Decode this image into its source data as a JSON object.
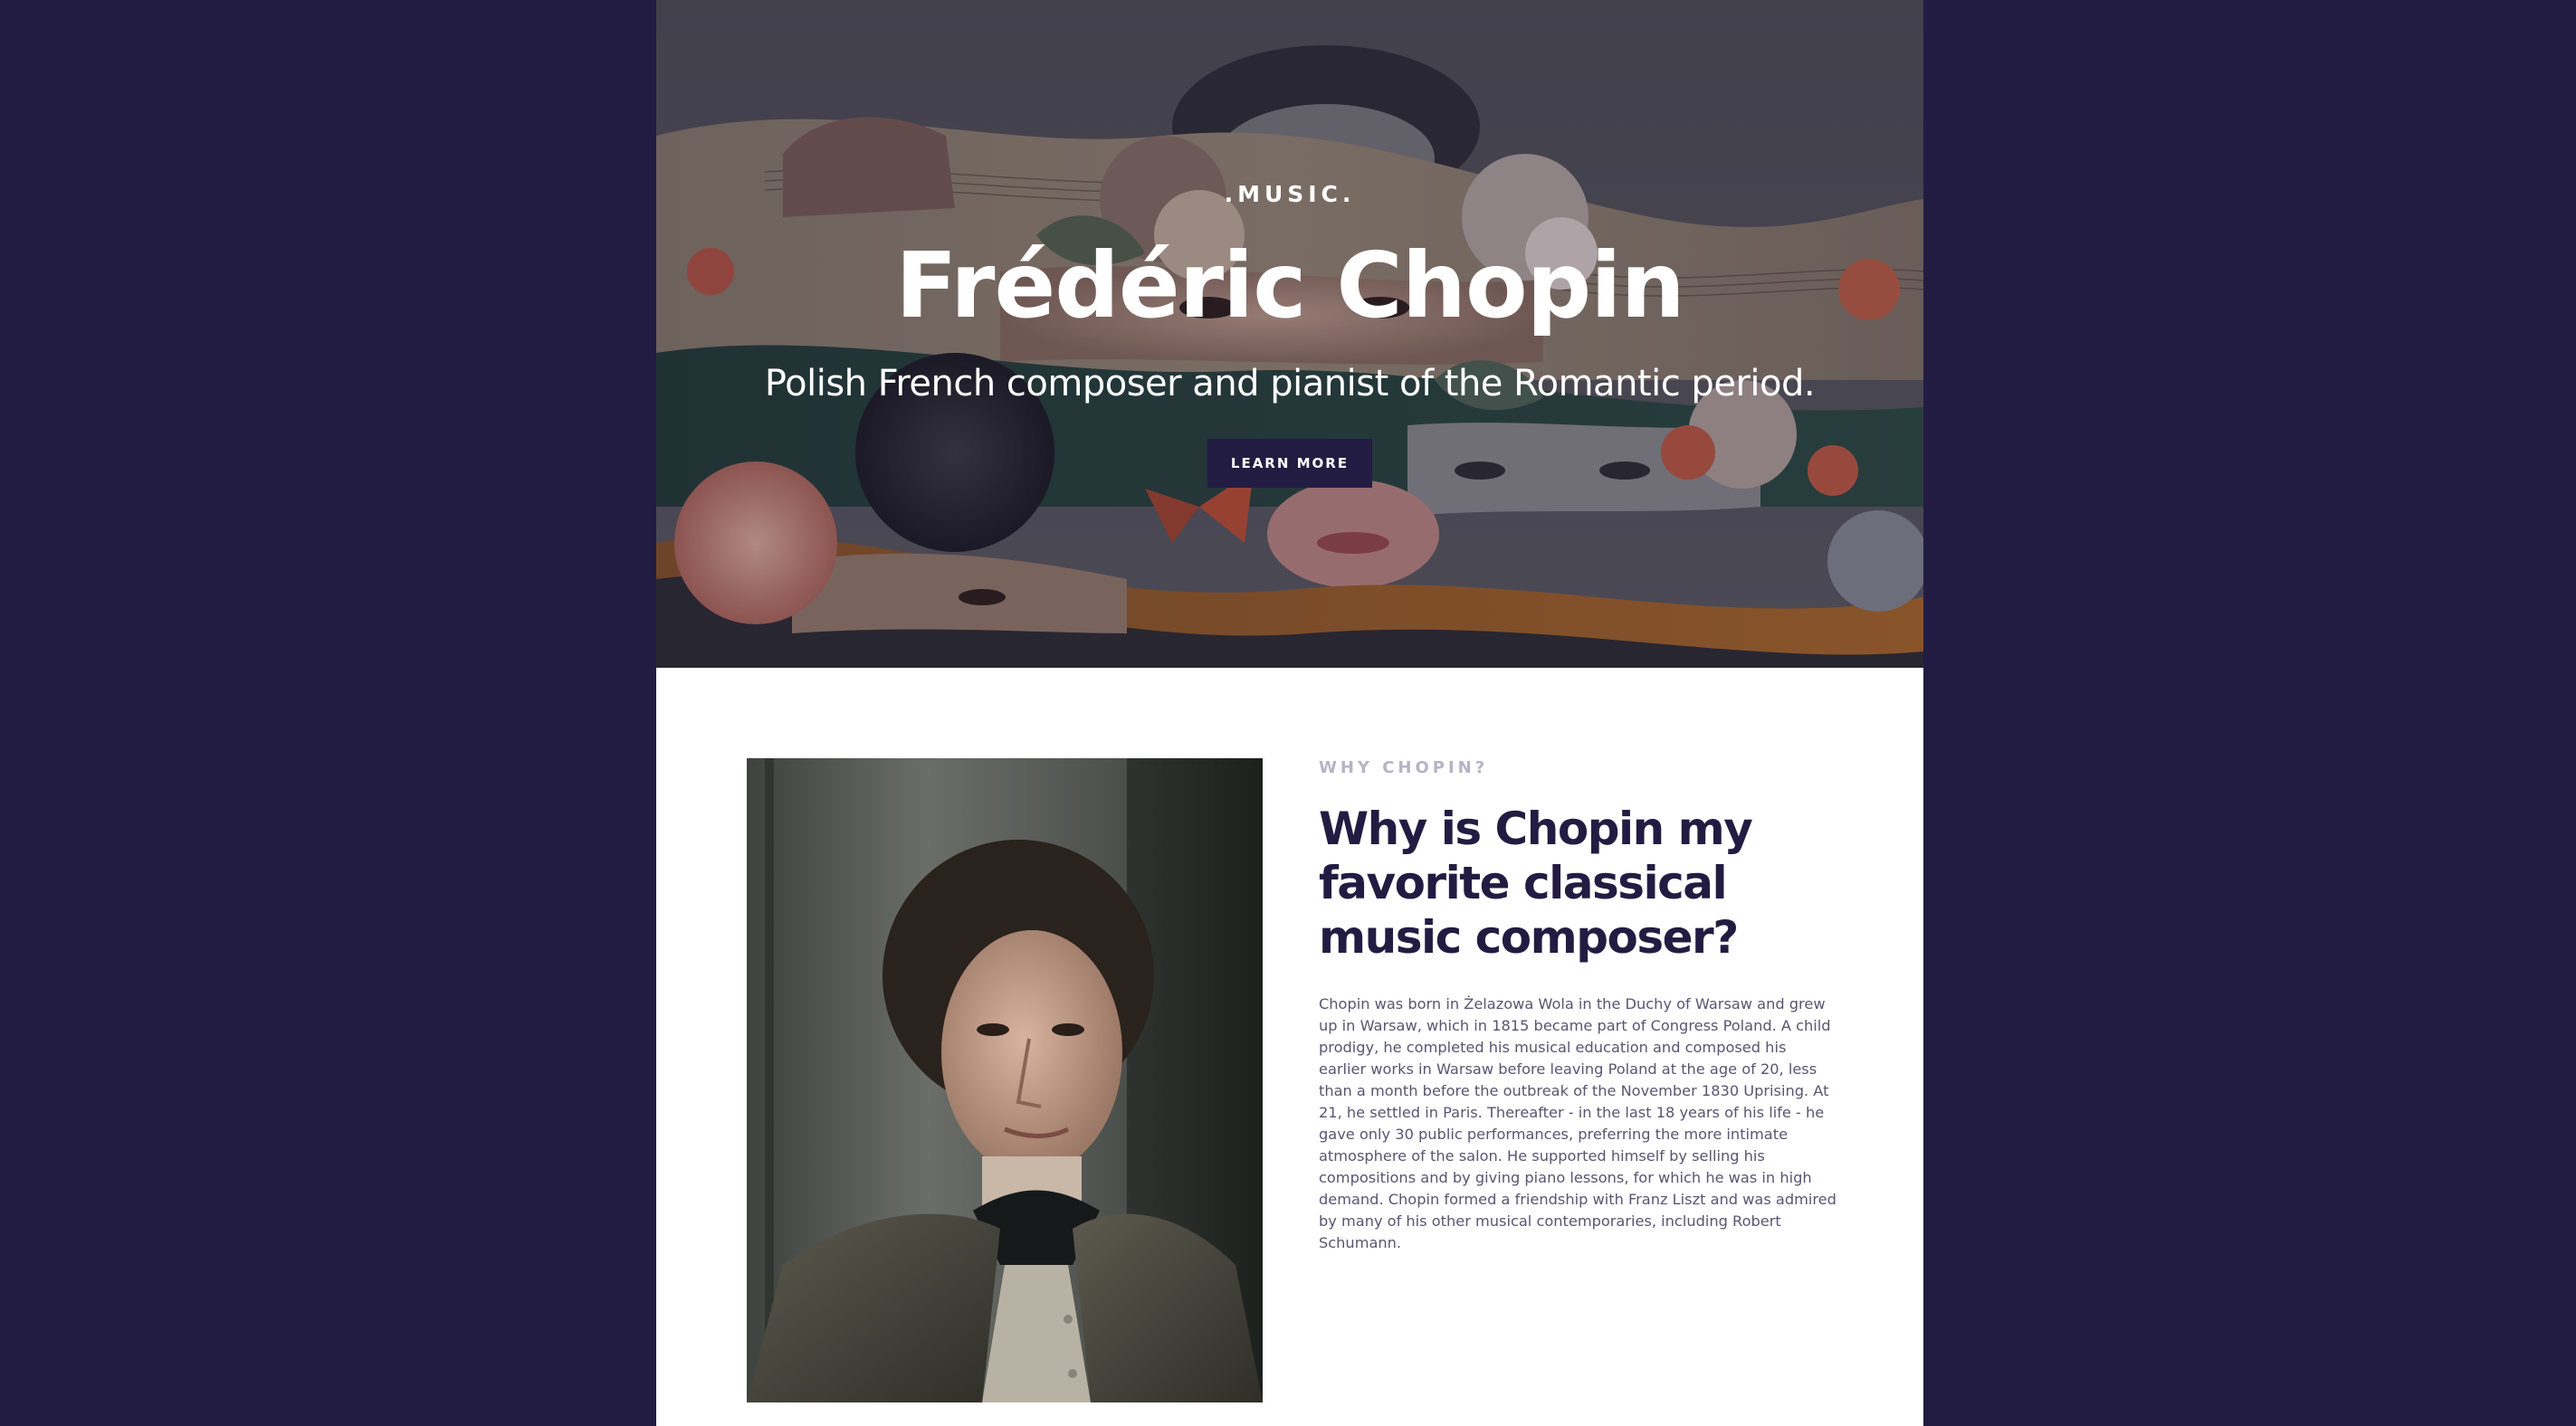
{
  "hero": {
    "eyebrow": ".MUSIC.",
    "title": "Frédéric Chopin",
    "subtitle": "Polish French composer and pianist of the Romantic period.",
    "button_label": "LEARN MORE"
  },
  "about": {
    "eyebrow": "WHY CHOPIN?",
    "heading": "Why is Chopin my favorite classical music composer?",
    "body": "Chopin was born in Żelazowa Wola in the Duchy of Warsaw and grew up in Warsaw, which in 1815 became part of Congress Poland. A child prodigy, he completed his musical education and composed his earlier works in Warsaw before leaving Poland at the age of 20, less than a month before the outbreak of the November 1830 Uprising. At 21, he settled in Paris. Thereafter - in the last 18 years of his life - he gave only 30 public performances, preferring the more intimate atmosphere of the salon. He supported himself by selling his compositions and by giving piano lessons, for which he was in high demand. Chopin formed a friendship with Franz Liszt and was admired by many of his other musical contemporaries, including Robert Schumann."
  },
  "colors": {
    "page_background": "#231c42",
    "accent": "#231c42",
    "content_background": "#ffffff",
    "eyebrow_muted": "#b6b3c3",
    "body_text": "#5a5570"
  }
}
